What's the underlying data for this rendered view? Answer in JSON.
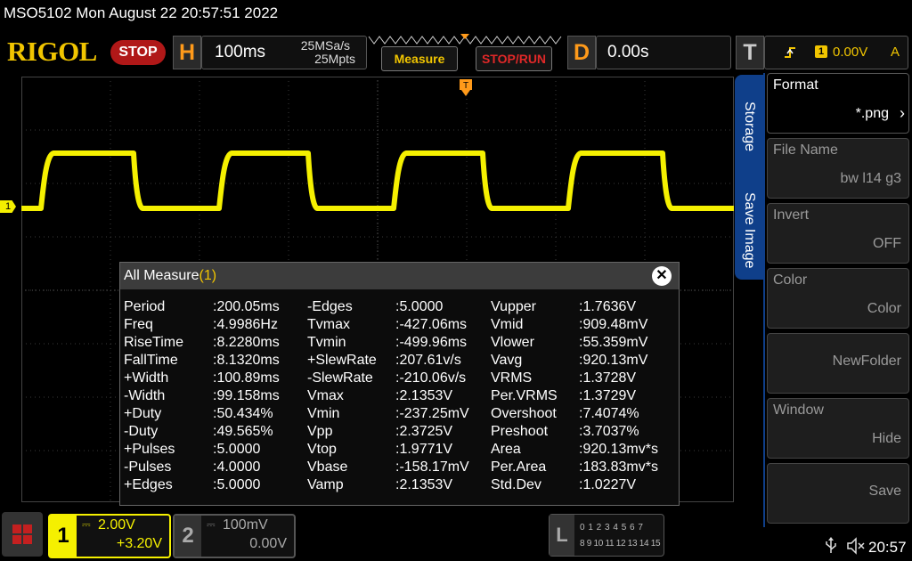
{
  "header": {
    "title": "MSO5102  Mon August 22 20:57:51 2022",
    "logo": "RIGOL",
    "run_state": "STOP",
    "horizontal": {
      "letter": "H",
      "timebase": "100ms",
      "sample_rate": "25MSa/s",
      "memory_depth": "25Mpts"
    },
    "measure_button": "Measure",
    "stoprun_button": "STOP/RUN",
    "delay": {
      "letter": "D",
      "value": "0.00s"
    },
    "trigger": {
      "letter": "T",
      "source": "1",
      "level": "0.00V",
      "coupling": "A"
    }
  },
  "waveform": {
    "channel_marker": "1",
    "color": "#f5f000"
  },
  "measure": {
    "title": "All Measure",
    "channel": "(1)",
    "close": "✕",
    "col1": [
      [
        "Period",
        ":200.05ms"
      ],
      [
        "Freq",
        ":4.9986Hz"
      ],
      [
        "RiseTime",
        ":8.2280ms"
      ],
      [
        "FallTime",
        ":8.1320ms"
      ],
      [
        "+Width",
        ":100.89ms"
      ],
      [
        "-Width",
        ":99.158ms"
      ],
      [
        "+Duty",
        ":50.434%"
      ],
      [
        "-Duty",
        ":49.565%"
      ],
      [
        "+Pulses",
        ":5.0000"
      ],
      [
        "-Pulses",
        ":4.0000"
      ],
      [
        "+Edges",
        ":5.0000"
      ]
    ],
    "col2": [
      [
        "-Edges",
        ":5.0000"
      ],
      [
        "Tvmax",
        ":-427.06ms"
      ],
      [
        "Tvmin",
        ":-499.96ms"
      ],
      [
        "+SlewRate",
        ":207.61v/s"
      ],
      [
        "-SlewRate",
        ":-210.06v/s"
      ],
      [
        "Vmax",
        ":2.1353V"
      ],
      [
        "Vmin",
        ":-237.25mV"
      ],
      [
        "Vpp",
        ":2.3725V"
      ],
      [
        "Vtop",
        ":1.9771V"
      ],
      [
        "Vbase",
        ":-158.17mV"
      ],
      [
        "Vamp",
        ":2.1353V"
      ]
    ],
    "col3": [
      [
        "Vupper",
        ":1.7636V"
      ],
      [
        "Vmid",
        ":909.48mV"
      ],
      [
        "Vlower",
        ":55.359mV"
      ],
      [
        "Vavg",
        ":920.13mV"
      ],
      [
        "VRMS",
        ":1.3728V"
      ],
      [
        "Per.VRMS",
        ":1.3729V"
      ],
      [
        "Overshoot",
        ":7.4074%"
      ],
      [
        "Preshoot",
        ":3.7037%"
      ],
      [
        "Area",
        ":920.13mv*s"
      ],
      [
        "Per.Area",
        ":183.83mv*s"
      ],
      [
        "Std.Dev",
        ":1.0227V"
      ]
    ]
  },
  "side_tabs": {
    "storage": "Storage",
    "save_image": "Save Image"
  },
  "menu": [
    {
      "label": "Format",
      "value": "*.png",
      "active": true
    },
    {
      "label": "File Name",
      "value": "bw l14 g3",
      "active": false
    },
    {
      "label": "Invert",
      "value": "OFF",
      "active": false
    },
    {
      "label": "Color",
      "value": "Color",
      "active": false
    },
    {
      "label": "",
      "value": "NewFolder",
      "active": false
    },
    {
      "label": "Window",
      "value": "Hide",
      "active": false
    },
    {
      "label": "",
      "value": "Save",
      "active": false
    }
  ],
  "bottom": {
    "ch1": {
      "num": "1",
      "scale": "2.00V",
      "offset": "+3.20V"
    },
    "ch2": {
      "num": "2",
      "scale": "100mV",
      "offset": "0.00V"
    },
    "logic": {
      "letter": "L",
      "row1": "0 1 2 3  4 5 6 7",
      "row2": "8 9 10 11  12 13 14 15"
    },
    "clock": "20:57"
  },
  "colors": {
    "accent_yellow": "#f1c500",
    "trace_yellow": "#f5f000",
    "orange": "#ff9a1a",
    "stop_red": "#b01818",
    "menu_blue": "#0f3f8a"
  }
}
